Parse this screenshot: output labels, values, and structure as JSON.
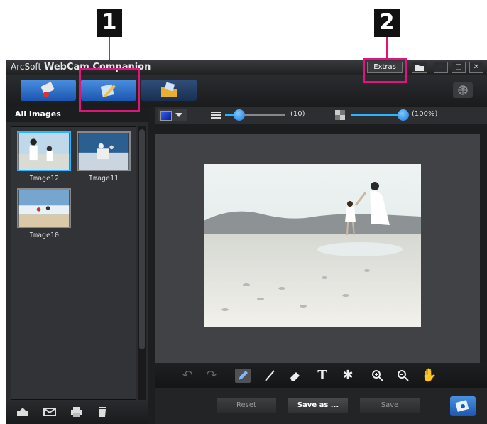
{
  "callouts": {
    "one": "1",
    "two": "2"
  },
  "window": {
    "brand": "ArcSoft",
    "app_name": "WebCam Companion",
    "extras_label": "Extras",
    "folder_icon": "folder-icon",
    "minimize_label": "–",
    "maximize_label": "□",
    "close_label": "✕"
  },
  "toolbar": {
    "modes": [
      {
        "icon": "capture-icon"
      },
      {
        "icon": "edit-icon"
      },
      {
        "icon": "open-folder-icon"
      }
    ],
    "globe_icon": "globe-icon"
  },
  "sidebar": {
    "title": "All Images",
    "images": [
      {
        "caption": "Image12",
        "selected": true
      },
      {
        "caption": "Image11",
        "selected": false
      },
      {
        "caption": "Image10",
        "selected": false
      }
    ],
    "bottom_icons": [
      "import-icon",
      "email-icon",
      "print-icon",
      "trash-icon"
    ]
  },
  "editor": {
    "brush_size": "(10)",
    "opacity": "(100%)",
    "brush_size_value": 10,
    "opacity_value": 100,
    "tools": [
      "undo-icon",
      "redo-icon",
      "pencil-icon",
      "line-icon",
      "eraser-icon",
      "text-icon",
      "stamp-icon",
      "zoom-in-icon",
      "zoom-out-icon",
      "hand-icon"
    ]
  },
  "actions": {
    "reset": "Reset",
    "save_as": "Save as ...",
    "save": "Save"
  },
  "colors": {
    "accent_blue": "#27b6ff",
    "highlight_pink": "#e0147c",
    "window_bg": "#1d1e20"
  }
}
